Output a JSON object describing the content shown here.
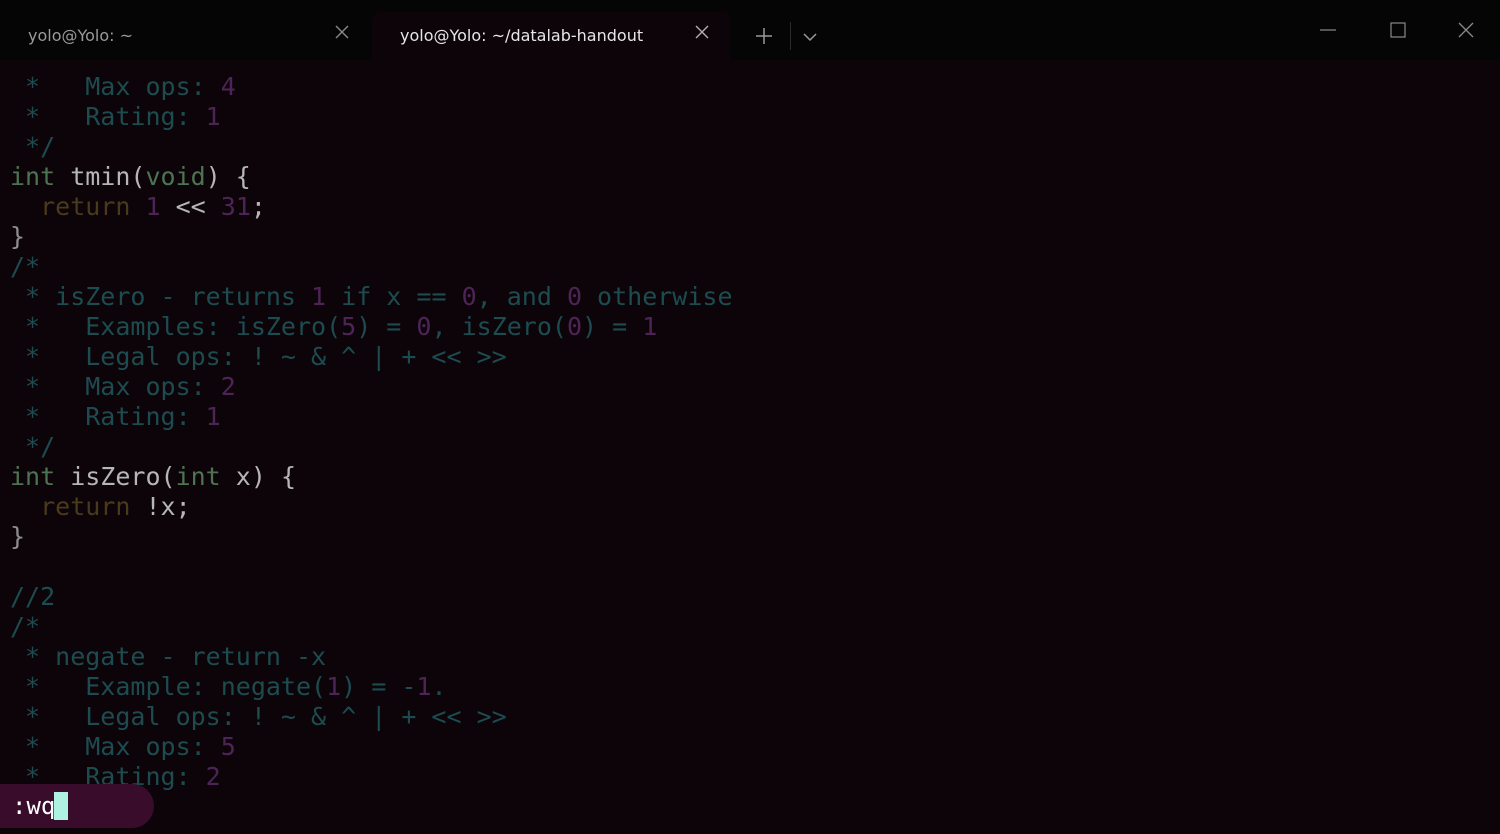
{
  "window": {
    "tabs": [
      {
        "title": "yolo@Yolo: ~",
        "active": false
      },
      {
        "title": "yolo@Yolo: ~/datalab-handout",
        "active": true
      }
    ],
    "icons": {
      "tab_close": "close-icon",
      "new_tab": "plus-icon",
      "dropdown": "chevron-down-icon",
      "minimize": "minimize-icon",
      "maximize": "maximize-icon",
      "close": "close-icon"
    }
  },
  "editor": {
    "lines": [
      [
        {
          "t": " *   Max ops: ",
          "c": "cm"
        },
        {
          "t": "4",
          "c": "num"
        }
      ],
      [
        {
          "t": " *   Rating: ",
          "c": "cm"
        },
        {
          "t": "1",
          "c": "num"
        }
      ],
      [
        {
          "t": " */",
          "c": "cm"
        }
      ],
      [
        {
          "t": "int",
          "c": "kw"
        },
        {
          "t": " tmin(",
          "c": "tx"
        },
        {
          "t": "void",
          "c": "kw"
        },
        {
          "t": ") {",
          "c": "tx"
        }
      ],
      [
        {
          "t": "  ",
          "c": "tx"
        },
        {
          "t": "return",
          "c": "ret"
        },
        {
          "t": " ",
          "c": "tx"
        },
        {
          "t": "1",
          "c": "num"
        },
        {
          "t": " << ",
          "c": "tx"
        },
        {
          "t": "31",
          "c": "num"
        },
        {
          "t": ";",
          "c": "tx"
        }
      ],
      [
        {
          "t": "}",
          "c": "br"
        }
      ],
      [
        {
          "t": "/*",
          "c": "cm"
        }
      ],
      [
        {
          "t": " * isZero - returns ",
          "c": "cm"
        },
        {
          "t": "1",
          "c": "num"
        },
        {
          "t": " if x == ",
          "c": "cm"
        },
        {
          "t": "0",
          "c": "num"
        },
        {
          "t": ", and ",
          "c": "cm"
        },
        {
          "t": "0",
          "c": "num"
        },
        {
          "t": " otherwise",
          "c": "cm"
        }
      ],
      [
        {
          "t": " *   Examples: isZero(",
          "c": "cm"
        },
        {
          "t": "5",
          "c": "num"
        },
        {
          "t": ") = ",
          "c": "cm"
        },
        {
          "t": "0",
          "c": "num"
        },
        {
          "t": ", isZero(",
          "c": "cm"
        },
        {
          "t": "0",
          "c": "num"
        },
        {
          "t": ") = ",
          "c": "cm"
        },
        {
          "t": "1",
          "c": "num"
        }
      ],
      [
        {
          "t": " *   Legal ops: ! ~ & ^ | + << >>",
          "c": "cm"
        }
      ],
      [
        {
          "t": " *   Max ops: ",
          "c": "cm"
        },
        {
          "t": "2",
          "c": "num"
        }
      ],
      [
        {
          "t": " *   Rating: ",
          "c": "cm"
        },
        {
          "t": "1",
          "c": "num"
        }
      ],
      [
        {
          "t": " */",
          "c": "cm"
        }
      ],
      [
        {
          "t": "int",
          "c": "kw"
        },
        {
          "t": " isZero(",
          "c": "tx"
        },
        {
          "t": "int",
          "c": "kw"
        },
        {
          "t": " x) {",
          "c": "tx"
        }
      ],
      [
        {
          "t": "  ",
          "c": "tx"
        },
        {
          "t": "return",
          "c": "ret"
        },
        {
          "t": " !x;",
          "c": "tx"
        }
      ],
      [
        {
          "t": "}",
          "c": "br"
        }
      ],
      [],
      [
        {
          "t": "//2",
          "c": "cm"
        }
      ],
      [
        {
          "t": "/*",
          "c": "cm"
        }
      ],
      [
        {
          "t": " * negate - return -x",
          "c": "cm"
        }
      ],
      [
        {
          "t": " *   Example: negate(",
          "c": "cm"
        },
        {
          "t": "1",
          "c": "num"
        },
        {
          "t": ") = -",
          "c": "cm"
        },
        {
          "t": "1",
          "c": "num"
        },
        {
          "t": ".",
          "c": "cm"
        }
      ],
      [
        {
          "t": " *   Legal ops: ! ~ & ^ | + << >>",
          "c": "cm"
        }
      ],
      [
        {
          "t": " *   Max ops: ",
          "c": "cm"
        },
        {
          "t": "5",
          "c": "num"
        }
      ],
      [
        {
          "t": " *   Rating: ",
          "c": "cm"
        },
        {
          "t": "2",
          "c": "num"
        }
      ]
    ]
  },
  "cmdline": {
    "text": ":wq"
  },
  "colors": {
    "background": "#0d0409",
    "titlebar": "#050505",
    "comment": "#1c4c50",
    "number": "#4e2458",
    "keyword": "#4c7452",
    "return_keyword": "#4a3a1c",
    "text": "#b6b6b6",
    "cmdline_bg": "#3a0c2c",
    "cursor": "#aef2e2"
  }
}
